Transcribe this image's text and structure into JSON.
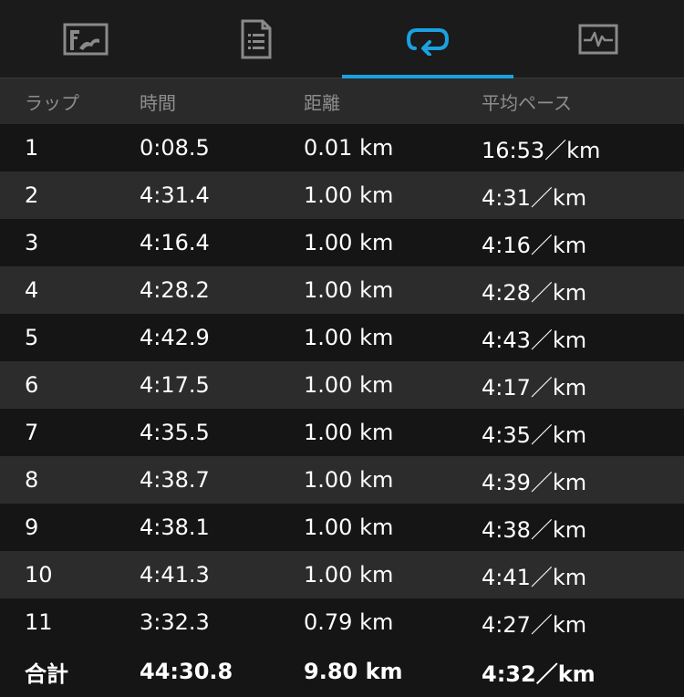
{
  "tabs": [
    {
      "icon": "map-icon",
      "active": false
    },
    {
      "icon": "details-list-icon",
      "active": false
    },
    {
      "icon": "laps-loop-icon",
      "active": true
    },
    {
      "icon": "activity-graph-icon",
      "active": false
    }
  ],
  "accent_color": "#1ba1e2",
  "table": {
    "headers": {
      "lap": "ラップ",
      "time": "時間",
      "distance": "距離",
      "pace": "平均ペース"
    },
    "rows": [
      {
        "lap": "1",
        "time": "0:08.5",
        "distance": "0.01 km",
        "pace": "16:53／km"
      },
      {
        "lap": "2",
        "time": "4:31.4",
        "distance": "1.00 km",
        "pace": "4:31／km"
      },
      {
        "lap": "3",
        "time": "4:16.4",
        "distance": "1.00 km",
        "pace": "4:16／km"
      },
      {
        "lap": "4",
        "time": "4:28.2",
        "distance": "1.00 km",
        "pace": "4:28／km"
      },
      {
        "lap": "5",
        "time": "4:42.9",
        "distance": "1.00 km",
        "pace": "4:43／km"
      },
      {
        "lap": "6",
        "time": "4:17.5",
        "distance": "1.00 km",
        "pace": "4:17／km"
      },
      {
        "lap": "7",
        "time": "4:35.5",
        "distance": "1.00 km",
        "pace": "4:35／km"
      },
      {
        "lap": "8",
        "time": "4:38.7",
        "distance": "1.00 km",
        "pace": "4:39／km"
      },
      {
        "lap": "9",
        "time": "4:38.1",
        "distance": "1.00 km",
        "pace": "4:38／km"
      },
      {
        "lap": "10",
        "time": "4:41.3",
        "distance": "1.00 km",
        "pace": "4:41／km"
      },
      {
        "lap": "11",
        "time": "3:32.3",
        "distance": "0.79 km",
        "pace": "4:27／km"
      }
    ],
    "total": {
      "label": "合計",
      "time": "44:30.8",
      "distance": "9.80 km",
      "pace": "4:32／km"
    }
  }
}
